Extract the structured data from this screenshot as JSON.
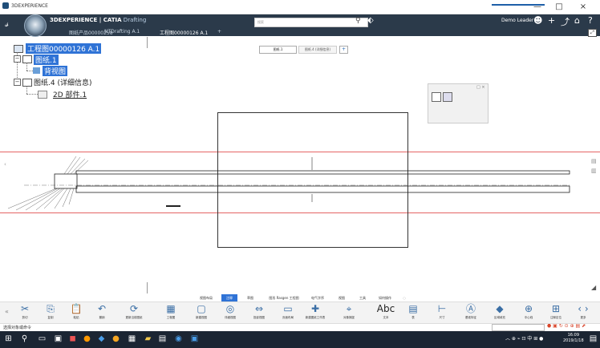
{
  "window": {
    "title": "3DEXPERIENCE",
    "minimize": "—",
    "maximize": "□",
    "close": "×"
  },
  "header": {
    "brand_main": "3DEXPERIENCE | CATIA",
    "brand_sub": " Drafting",
    "search_placeholder": "搜索",
    "user": "Demo Leader",
    "icons": [
      "compass-icon",
      "tag-icon",
      "user-icon",
      "add-icon",
      "share-icon",
      "home-icon",
      "help-icon"
    ]
  },
  "tabs": [
    {
      "label": "图纸产品00000258"
    },
    {
      "label": "NTDrafting A.1"
    },
    {
      "label": "工程图00000126 A.1"
    },
    {
      "label": "+"
    }
  ],
  "tree": {
    "root": "工程图00000126 A.1",
    "sheet1": "图纸.1",
    "background": "背视图",
    "sheet4": "图纸.4 (详细信息)",
    "detail": "2D 部件.1"
  },
  "sheet_tabs": {
    "sheet1": "图纸.1",
    "sheet4": "图纸.4 (详细信息)",
    "add": "+"
  },
  "ribbon_tabs": [
    {
      "label": "视图布局",
      "active": false
    },
    {
      "label": "注释",
      "active": true
    },
    {
      "label": "草图",
      "active": false
    },
    {
      "label": "图形 Rasgen 工程图",
      "active": false
    },
    {
      "label": "电气字序",
      "active": false
    },
    {
      "label": "视图",
      "active": false
    },
    {
      "label": "工具",
      "active": false
    },
    {
      "label": "如何操作",
      "active": false
    }
  ],
  "toolbar": [
    {
      "label": "剪切",
      "icon": "cut-icon"
    },
    {
      "label": "复制",
      "icon": "copy-icon"
    },
    {
      "label": "粘贴",
      "icon": "paste-icon"
    },
    {
      "label": "撤销",
      "icon": "undo-icon"
    },
    {
      "label": "更新当前图纸",
      "icon": "update-icon"
    },
    {
      "label": "工程图",
      "icon": "drawing-icon"
    },
    {
      "label": "新建视图",
      "icon": "new-view-icon"
    },
    {
      "label": "详细视图",
      "icon": "detail-view-icon"
    },
    {
      "label": "投影视图",
      "icon": "projection-icon"
    },
    {
      "label": "页面布局",
      "icon": "layout-icon"
    },
    {
      "label": "新建图纸工作表",
      "icon": "new-sheet-icon"
    },
    {
      "label": "对象捕捉",
      "icon": "snap-icon"
    },
    {
      "label": "文本",
      "icon": "text-icon"
    },
    {
      "label": "表",
      "icon": "table-icon"
    },
    {
      "label": "尺寸",
      "icon": "dimension-icon"
    },
    {
      "label": "基准特征",
      "icon": "datum-icon"
    },
    {
      "label": "区域填充",
      "icon": "fill-icon"
    },
    {
      "label": "中心线",
      "icon": "centerline-icon"
    },
    {
      "label": "注释定位",
      "icon": "annotation-icon"
    },
    {
      "label": "更多",
      "icon": "more-icon"
    }
  ],
  "status": {
    "text": "选择对象或命令"
  },
  "taskbar": {
    "time": "16:09",
    "date": "2019/1/18"
  }
}
